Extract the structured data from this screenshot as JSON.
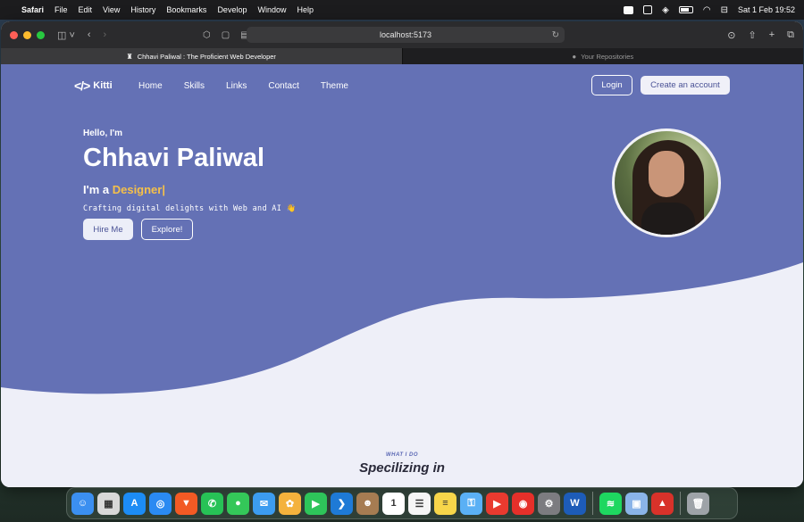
{
  "menubar": {
    "app": "Safari",
    "items": [
      "File",
      "Edit",
      "View",
      "History",
      "Bookmarks",
      "Develop",
      "Window",
      "Help"
    ],
    "clock": "Sat 1 Feb  19:52"
  },
  "browser": {
    "url": "localhost:5173",
    "tabs": [
      {
        "title": "Chhavi Paliwal : The Proficient Web Developer"
      },
      {
        "title": "Your Repositories"
      }
    ]
  },
  "site": {
    "logo_text": "Kitti",
    "logo_glyph": "</>",
    "nav": [
      "Home",
      "Skills",
      "Links",
      "Contact",
      "Theme"
    ],
    "login": "Login",
    "create_account": "Create an account",
    "hello": "Hello, I'm",
    "name": "Chhavi Paliwal",
    "role_prefix": "I'm a ",
    "role_typed": "Designer|",
    "tagline": "Crafting digital delights with Web and AI 👋",
    "hire_me": "Hire Me",
    "explore": "Explore!",
    "section_eyebrow": "WHAT I DO",
    "section_title": "Specilizing in"
  },
  "colors": {
    "hero": "#6471b5",
    "accent": "#f5c04a",
    "page_bg": "#eeeff8"
  },
  "dock": {
    "apps": [
      {
        "name": "finder-icon",
        "color": "#3b8ff0",
        "glyph": "☺"
      },
      {
        "name": "launchpad-icon",
        "color": "#d8d8d8",
        "glyph": "▦"
      },
      {
        "name": "app-store-icon",
        "color": "#1c8cf5",
        "glyph": "A"
      },
      {
        "name": "safari-icon",
        "color": "#2a8af2",
        "glyph": "◎"
      },
      {
        "name": "brave-icon",
        "color": "#f25a24",
        "glyph": "▼"
      },
      {
        "name": "whatsapp-icon",
        "color": "#27c256",
        "glyph": "✆"
      },
      {
        "name": "messages-icon",
        "color": "#34c759",
        "glyph": "●"
      },
      {
        "name": "mail-icon",
        "color": "#3c9cf0",
        "glyph": "✉"
      },
      {
        "name": "photos-icon",
        "color": "#f4b23c",
        "glyph": "✿"
      },
      {
        "name": "facetime-icon",
        "color": "#2ec55a",
        "glyph": "▶"
      },
      {
        "name": "vscode-icon",
        "color": "#1e7ad6",
        "glyph": "❯"
      },
      {
        "name": "contacts-icon",
        "color": "#a67c52",
        "glyph": "☻"
      },
      {
        "name": "calendar-icon",
        "color": "#ffffff",
        "glyph": "1"
      },
      {
        "name": "reminders-icon",
        "color": "#f5f5f5",
        "glyph": "☰"
      },
      {
        "name": "notes-icon",
        "color": "#f7d64a",
        "glyph": "≡"
      },
      {
        "name": "passwords-icon",
        "color": "#5ab0f5",
        "glyph": "⚿"
      },
      {
        "name": "youtube-icon",
        "color": "#e93a2f",
        "glyph": "▶"
      },
      {
        "name": "youtube-music-icon",
        "color": "#e5302a",
        "glyph": "◉"
      },
      {
        "name": "system-settings-icon",
        "color": "#7c7c80",
        "glyph": "⚙"
      },
      {
        "name": "word-icon",
        "color": "#1d5cb8",
        "glyph": "W"
      },
      {
        "name": "spotify-icon",
        "color": "#1ed760",
        "glyph": "≋"
      },
      {
        "name": "preview-icon",
        "color": "#8ab4e8",
        "glyph": "▣"
      },
      {
        "name": "acrobat-icon",
        "color": "#d8322a",
        "glyph": "▲"
      },
      {
        "name": "trash-icon",
        "color": "#9ea3a8",
        "glyph": "🗑"
      }
    ]
  }
}
